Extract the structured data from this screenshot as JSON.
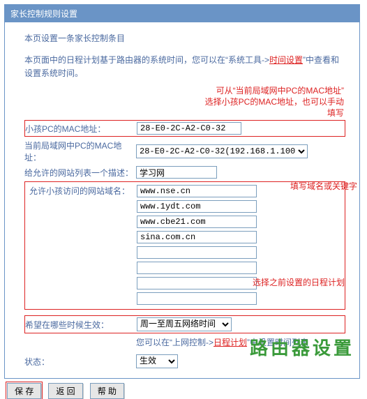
{
  "panel_title": "家长控制规则设置",
  "intro1": "本页设置一条家长控制条目",
  "intro2_prefix": "本页面中的日程计划基于路由器的系统时间，您可以在“系统工具->",
  "intro2_link": "时间设置",
  "intro2_suffix": "”中查看和设置系统时间。",
  "note_top_line1": "可从“当前局域网中PC的MAC地址”",
  "note_top_line2": "选择小孩PC的MAC地址，也可以手动",
  "note_top_line3": "填写",
  "labels": {
    "child_mac": "小孩PC的MAC地址：",
    "lan_mac": "当前局域网中PC的MAC地址：",
    "desc": "给允许的网站列表一个描述：",
    "domains": "允许小孩访问的网站域名：",
    "schedule": "希望在哪些时候生效：",
    "status": "状态："
  },
  "values": {
    "child_mac": "28-E0-2C-A2-C0-32",
    "lan_mac": "28-E0-2C-A2-C0-32(192.168.1.100)",
    "desc": "学习网",
    "domains": [
      "www.nse.cn",
      "www.1ydt.com",
      "www.cbe21.com",
      "sina.com.cn",
      "",
      "",
      "",
      ""
    ],
    "schedule": "周一至周五网络时间",
    "status": "生效"
  },
  "notes": {
    "domain_side": "填写域名或关键字",
    "schedule_side": "选择之前设置的日程计划"
  },
  "aux_prefix": "您可以在“上网控制->",
  "aux_link": "日程计划",
  "aux_suffix": "”中设置时间列表",
  "buttons": {
    "save": "保 存",
    "back": "返 回",
    "help": "帮 助"
  },
  "brand": "路由器设置"
}
